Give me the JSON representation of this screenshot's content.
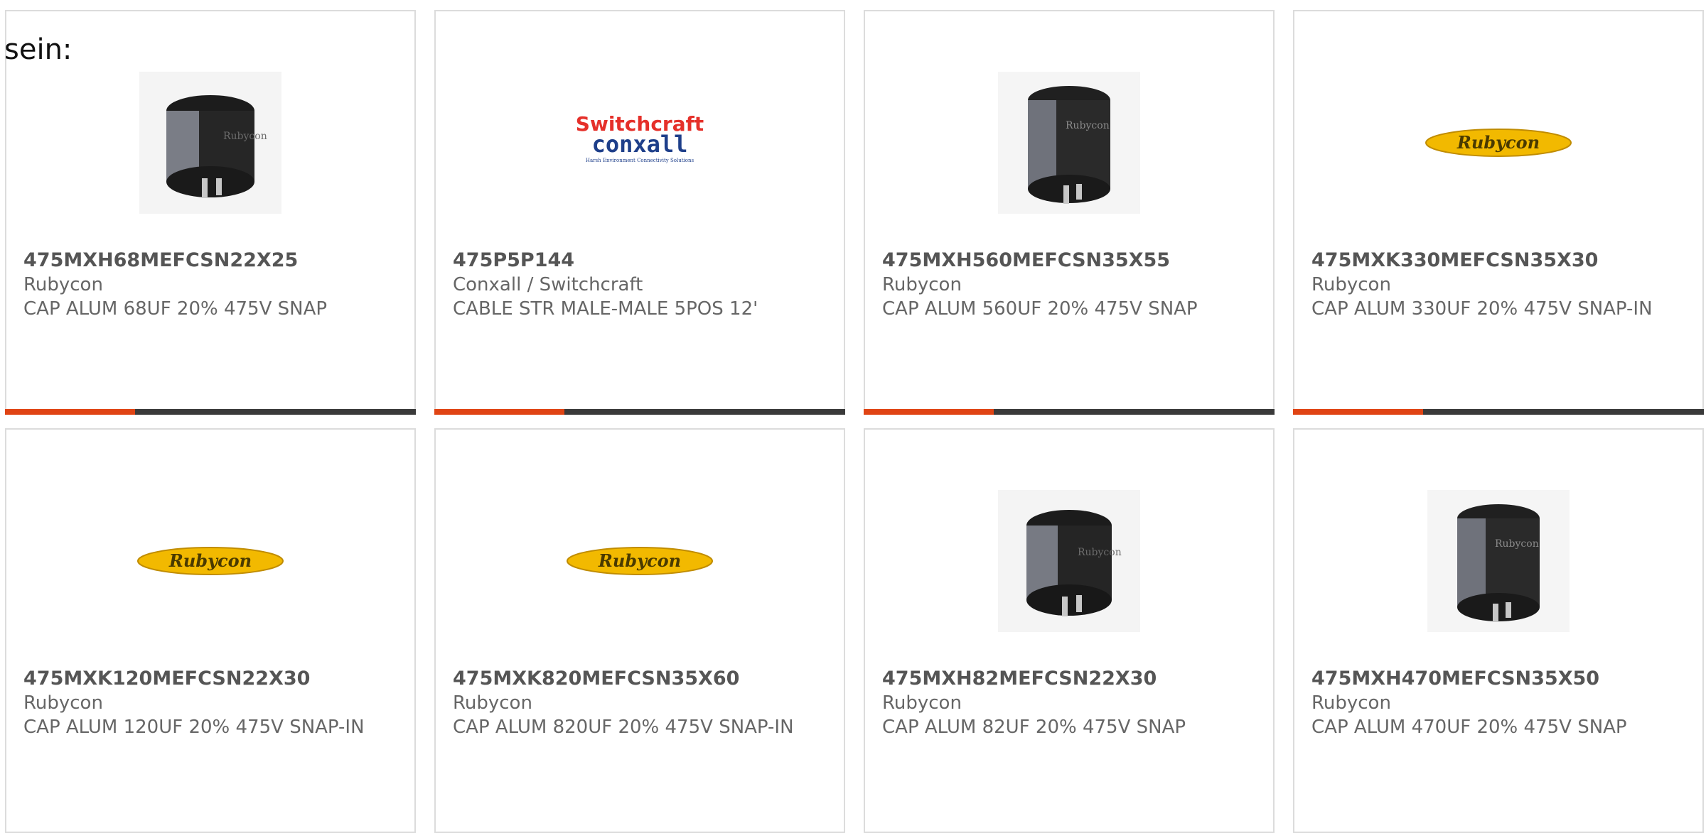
{
  "prefix_text": "sein:",
  "colors": {
    "accent": "#e04414",
    "bar": "#3a3a3a",
    "rubycon_yellow": "#f2b900",
    "rubycon_text": "#4a3a00",
    "switchcraft_red": "#e5302a",
    "conxall_blue": "#1e3f8a"
  },
  "products": [
    {
      "part_number": "475MXH68MEFCSN22X25",
      "manufacturer": "Rubycon",
      "description": "CAP ALUM 68UF 20% 475V SNAP",
      "image": "capacitor-photo"
    },
    {
      "part_number": "475P5P144",
      "manufacturer": "Conxall / Switchcraft",
      "description": "CABLE STR MALE-MALE 5POS 12'",
      "image": "switchcraft-conxall-logo",
      "logo": {
        "line1": "Switchcraft",
        "line2": "conxall",
        "tagline": "Harsh Environment Connectivity Solutions"
      }
    },
    {
      "part_number": "475MXH560MEFCSN35X55",
      "manufacturer": "Rubycon",
      "description": "CAP ALUM 560UF 20% 475V SNAP",
      "image": "capacitor-photo"
    },
    {
      "part_number": "475MXK330MEFCSN35X30",
      "manufacturer": "Rubycon",
      "description": "CAP ALUM 330UF 20% 475V SNAP-IN",
      "image": "rubycon-logo",
      "logo": {
        "text": "Rubycon"
      }
    },
    {
      "part_number": "475MXK120MEFCSN22X30",
      "manufacturer": "Rubycon",
      "description": "CAP ALUM 120UF 20% 475V SNAP-IN",
      "image": "rubycon-logo",
      "logo": {
        "text": "Rubycon"
      }
    },
    {
      "part_number": "475MXK820MEFCSN35X60",
      "manufacturer": "Rubycon",
      "description": "CAP ALUM 820UF 20% 475V SNAP-IN",
      "image": "rubycon-logo",
      "logo": {
        "text": "Rubycon"
      }
    },
    {
      "part_number": "475MXH82MEFCSN22X30",
      "manufacturer": "Rubycon",
      "description": "CAP ALUM 82UF 20% 475V SNAP",
      "image": "capacitor-photo"
    },
    {
      "part_number": "475MXH470MEFCSN35X50",
      "manufacturer": "Rubycon",
      "description": "CAP ALUM 470UF 20% 475V SNAP",
      "image": "capacitor-photo"
    }
  ]
}
